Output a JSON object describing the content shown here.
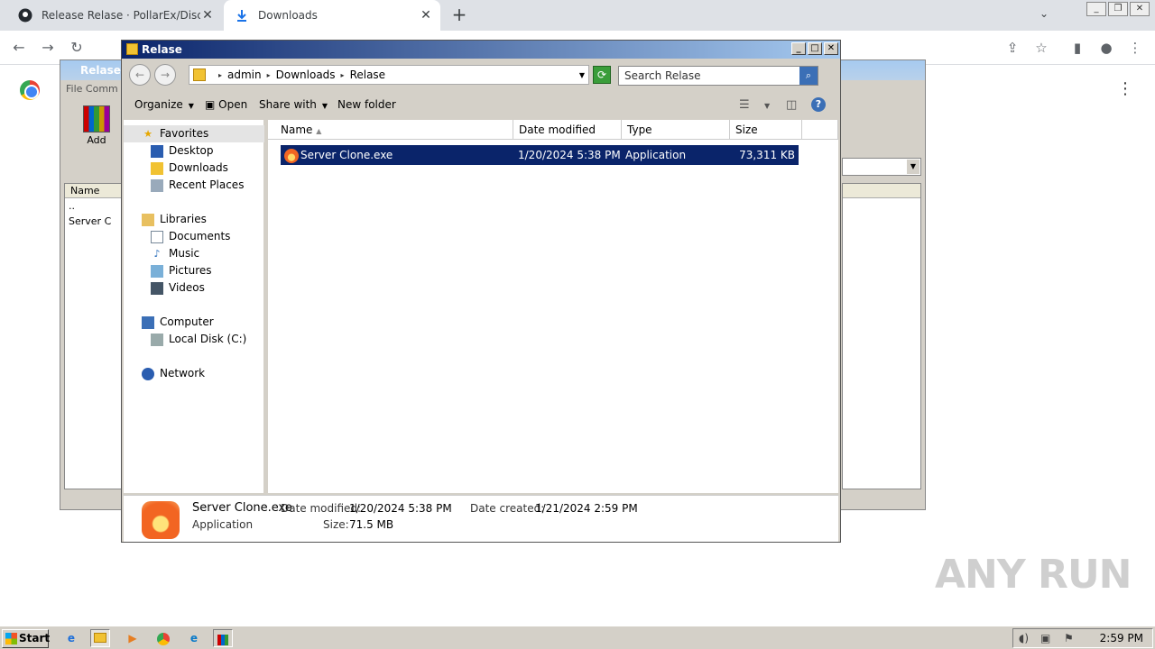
{
  "chrome": {
    "tabs": [
      {
        "label": "Release Relase · PollarEx/Discord-Se"
      },
      {
        "label": "Downloads"
      }
    ],
    "close": "✕",
    "new_tab": "+"
  },
  "winrar": {
    "title": "Relase.r",
    "menu": "File   Comm",
    "add_label": "Add",
    "list_header": "Name",
    "rows": [
      "..",
      "Server C"
    ]
  },
  "explorer": {
    "title": "Relase",
    "breadcrumb": [
      "admin",
      "Downloads",
      "Relase"
    ],
    "search_placeholder": "Search Relase",
    "commands": {
      "organize": "Organize",
      "open": "Open",
      "share_with": "Share with",
      "new_folder": "New folder"
    },
    "nav": {
      "favorites": "Favorites",
      "desktop": "Desktop",
      "downloads": "Downloads",
      "recent_places": "Recent Places",
      "libraries": "Libraries",
      "documents": "Documents",
      "music": "Music",
      "pictures": "Pictures",
      "videos": "Videos",
      "computer": "Computer",
      "local_disk": "Local Disk (C:)",
      "network": "Network"
    },
    "columns": {
      "name": "Name",
      "date_modified": "Date modified",
      "type": "Type",
      "size": "Size"
    },
    "files": [
      {
        "name": "Server Clone.exe",
        "date_modified": "1/20/2024 5:38 PM",
        "type": "Application",
        "size": "73,311 KB"
      }
    ],
    "details": {
      "filename": "Server Clone.exe",
      "type": "Application",
      "date_modified_label": "Date modified:",
      "date_modified": "1/20/2024 5:38 PM",
      "date_created_label": "Date created:",
      "date_created": "1/21/2024 2:59 PM",
      "size_label": "Size:",
      "size": "71.5 MB"
    }
  },
  "watermark": "ANY RUN",
  "taskbar": {
    "start_label": "Start",
    "clock": "2:59 PM"
  }
}
